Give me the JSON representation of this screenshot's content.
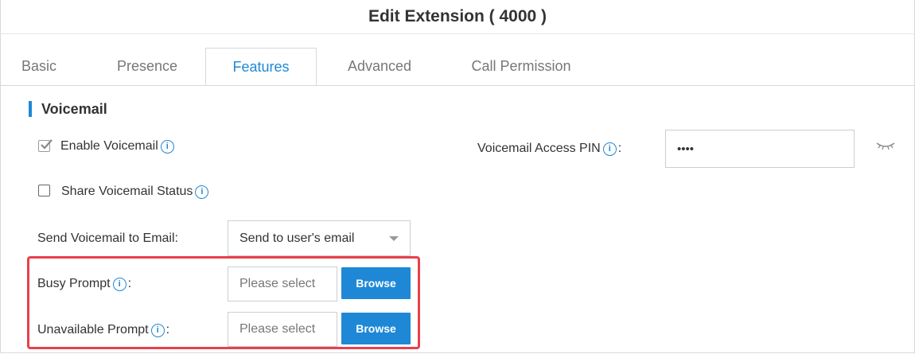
{
  "window": {
    "title": "Edit Extension ( 4000 )"
  },
  "tabs": [
    {
      "label": "Basic"
    },
    {
      "label": "Presence"
    },
    {
      "label": "Features"
    },
    {
      "label": "Advanced"
    },
    {
      "label": "Call Permission"
    }
  ],
  "active_tab": "Features",
  "section": {
    "title": "Voicemail"
  },
  "enable_voicemail": {
    "label": "Enable Voicemail",
    "checked": true
  },
  "share_status": {
    "label": "Share Voicemail Status",
    "checked": false
  },
  "access_pin": {
    "label": "Voicemail Access PIN",
    "colon": ":",
    "value": "••••"
  },
  "send_email": {
    "label": "Send Voicemail to Email:",
    "selected": "Send to user's email"
  },
  "busy_prompt": {
    "label": "Busy Prompt",
    "colon": ":",
    "placeholder": "Please select",
    "button": "Browse"
  },
  "unavailable_prompt": {
    "label": "Unavailable Prompt",
    "colon": ":",
    "placeholder": "Please select",
    "button": "Browse"
  },
  "icons": {
    "info": "info-icon",
    "eye": "eye-closed-icon",
    "check": "checkmark-icon",
    "dropdown": "chevron-down-icon"
  },
  "colors": {
    "accent": "#1e88d6",
    "highlight": "#e8404c",
    "text": "#333333"
  }
}
